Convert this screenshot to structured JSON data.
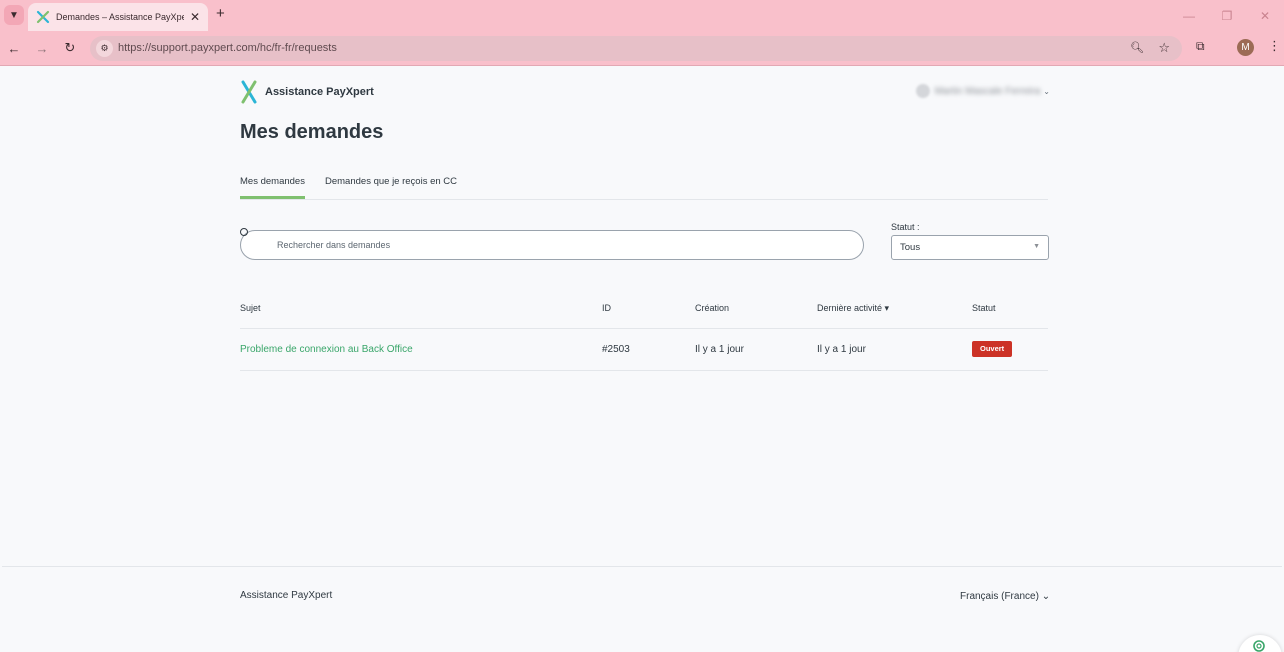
{
  "browser": {
    "tab_title": "Demandes – Assistance PayXpert",
    "url": "https://support.payxpert.com/hc/fr-fr/requests",
    "profile_initial": "M"
  },
  "header": {
    "brand_name": "Assistance PayXpert",
    "user_name": "Martin Mascale Ferreira"
  },
  "page": {
    "title": "Mes demandes",
    "tabs": [
      {
        "label": "Mes demandes",
        "active": true
      },
      {
        "label": "Demandes que je reçois en CC",
        "active": false
      }
    ]
  },
  "search": {
    "placeholder": "Rechercher dans demandes"
  },
  "status_filter": {
    "label": "Statut :",
    "selected": "Tous"
  },
  "table": {
    "columns": [
      "Sujet",
      "ID",
      "Création",
      "Dernière activité ▾",
      "Statut"
    ],
    "rows": [
      {
        "subject": "Probleme de connexion au Back Office",
        "id": "#2503",
        "created": "Il y a 1 jour",
        "last_activity": "Il y a 1 jour",
        "status": "Ouvert"
      }
    ]
  },
  "footer": {
    "brand": "Assistance PayXpert",
    "language": "Français (France)"
  },
  "colors": {
    "accent_green": "#3aa66a",
    "tab_underline": "#7fc06f",
    "status_open": "#cc3226",
    "chrome_pink": "#f9c0cb"
  }
}
